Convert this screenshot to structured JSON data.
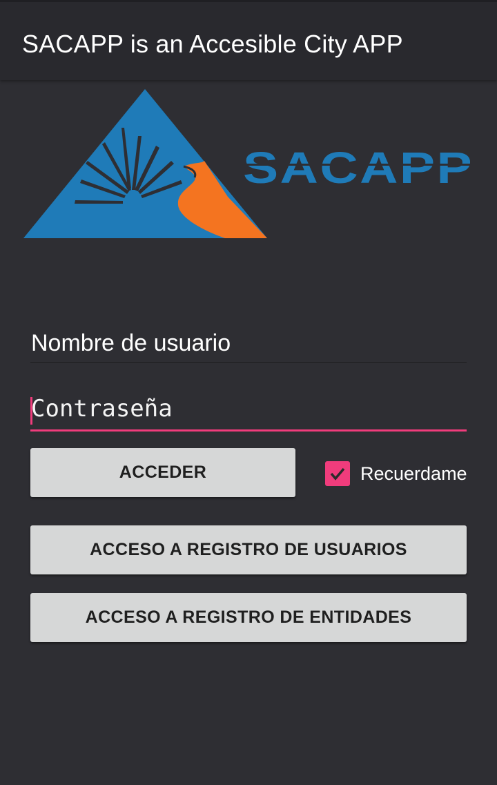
{
  "app_bar": {
    "title": "SACAPP is an Accesible City APP"
  },
  "logo": {
    "wordmark": "SACAPP",
    "colors": {
      "blue": "#1f7bb8",
      "orange": "#f47420",
      "dark": "#2e2e33"
    }
  },
  "form": {
    "username": {
      "value": "Nombre de usuario"
    },
    "password": {
      "placeholder": "Contraseña"
    },
    "login_button": "ACCEDER",
    "remember": {
      "label": "Recuerdame",
      "checked": true
    },
    "register_users_button": "ACCESO A REGISTRO DE USUARIOS",
    "register_entities_button": "ACCESO A REGISTRO DE ENTIDADES"
  },
  "colors": {
    "accent": "#f03c7c",
    "background": "#2e2e33",
    "app_bar": "#29292e",
    "button": "#d6d7d7"
  }
}
